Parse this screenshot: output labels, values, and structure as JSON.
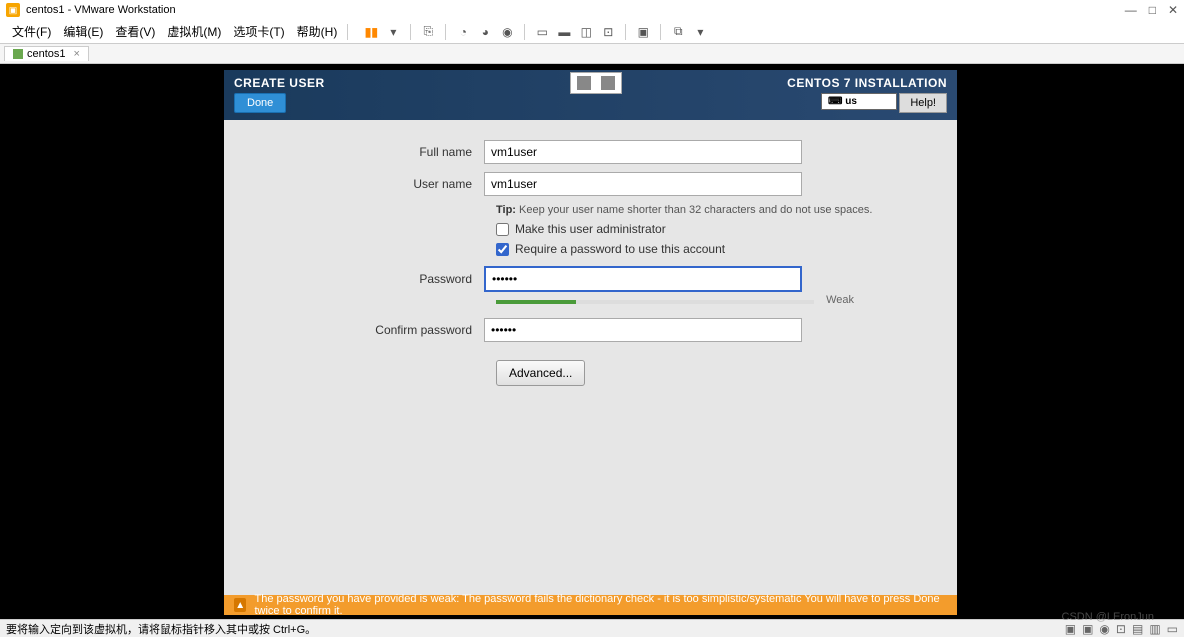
{
  "titlebar": {
    "title": "centos1 - VMware Workstation"
  },
  "menu": {
    "file": "文件(F)",
    "edit": "编辑(E)",
    "view": "查看(V)",
    "vm": "虚拟机(M)",
    "tabs": "选项卡(T)",
    "help": "帮助(H)"
  },
  "tab": {
    "name": "centos1"
  },
  "installer": {
    "create_user": "CREATE USER",
    "done": "Done",
    "title": "CENTOS 7 INSTALLATION",
    "keyboard_lang": "us",
    "help": "Help!",
    "form": {
      "full_name_label": "Full name",
      "full_name_value": "vm1user",
      "user_name_label": "User name",
      "user_name_value": "vm1user",
      "tip_label": "Tip:",
      "tip_text": "Keep your user name shorter than 32 characters and do not use spaces.",
      "make_admin": "Make this user administrator",
      "require_password": "Require a password to use this account",
      "password_label": "Password",
      "password_value": "••••••",
      "strength_label": "Weak",
      "confirm_label": "Confirm password",
      "confirm_value": "••••••",
      "advanced": "Advanced..."
    },
    "warning": "The password you have provided is weak: The password fails the dictionary check - it is too simplistic/systematic You will have to press Done twice to confirm it."
  },
  "statusbar": {
    "hint": "要将输入定向到该虚拟机，请将鼠标指针移入其中或按 Ctrl+G。"
  },
  "watermark": "CSDN @LEronJun"
}
